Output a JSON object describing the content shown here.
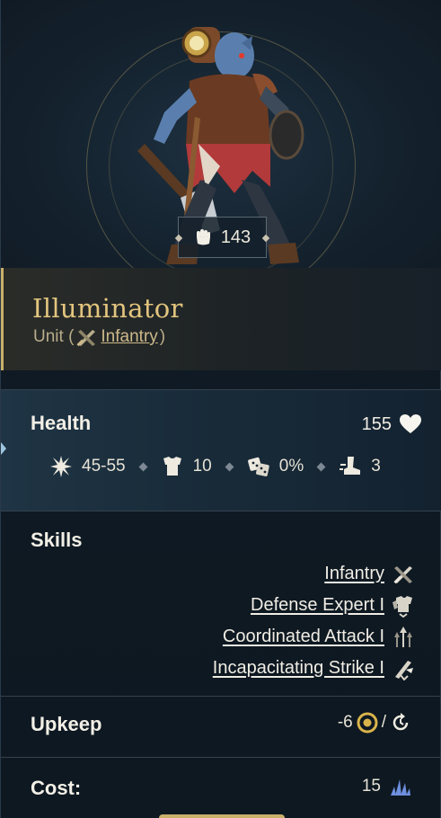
{
  "unit": {
    "name": "Illuminator",
    "type_prefix": "Unit (",
    "type_link": "Infantry",
    "type_suffix": ")",
    "power": "143"
  },
  "health": {
    "label": "Health",
    "value": "155",
    "damage": "45-55",
    "defense": "10",
    "chance": "0%",
    "movement": "3"
  },
  "skills": {
    "label": "Skills",
    "items": [
      {
        "label": "Infantry",
        "icon": "infantry-icon"
      },
      {
        "label": "Defense Expert I",
        "icon": "defense-expert-icon"
      },
      {
        "label": "Coordinated Attack I",
        "icon": "coordinated-attack-icon"
      },
      {
        "label": "Incapacitating Strike I",
        "icon": "incapacitating-strike-icon"
      }
    ]
  },
  "upkeep": {
    "label": "Upkeep",
    "value": "-6",
    "separator": "/"
  },
  "cost": {
    "label": "Cost:",
    "value": "15"
  },
  "colors": {
    "gold": "#c9b06a",
    "title_gold": "#e3c57e",
    "panel_bg": "#101a24",
    "health_bg": "#1f3444",
    "cost_blue": "#6e8fe0"
  }
}
